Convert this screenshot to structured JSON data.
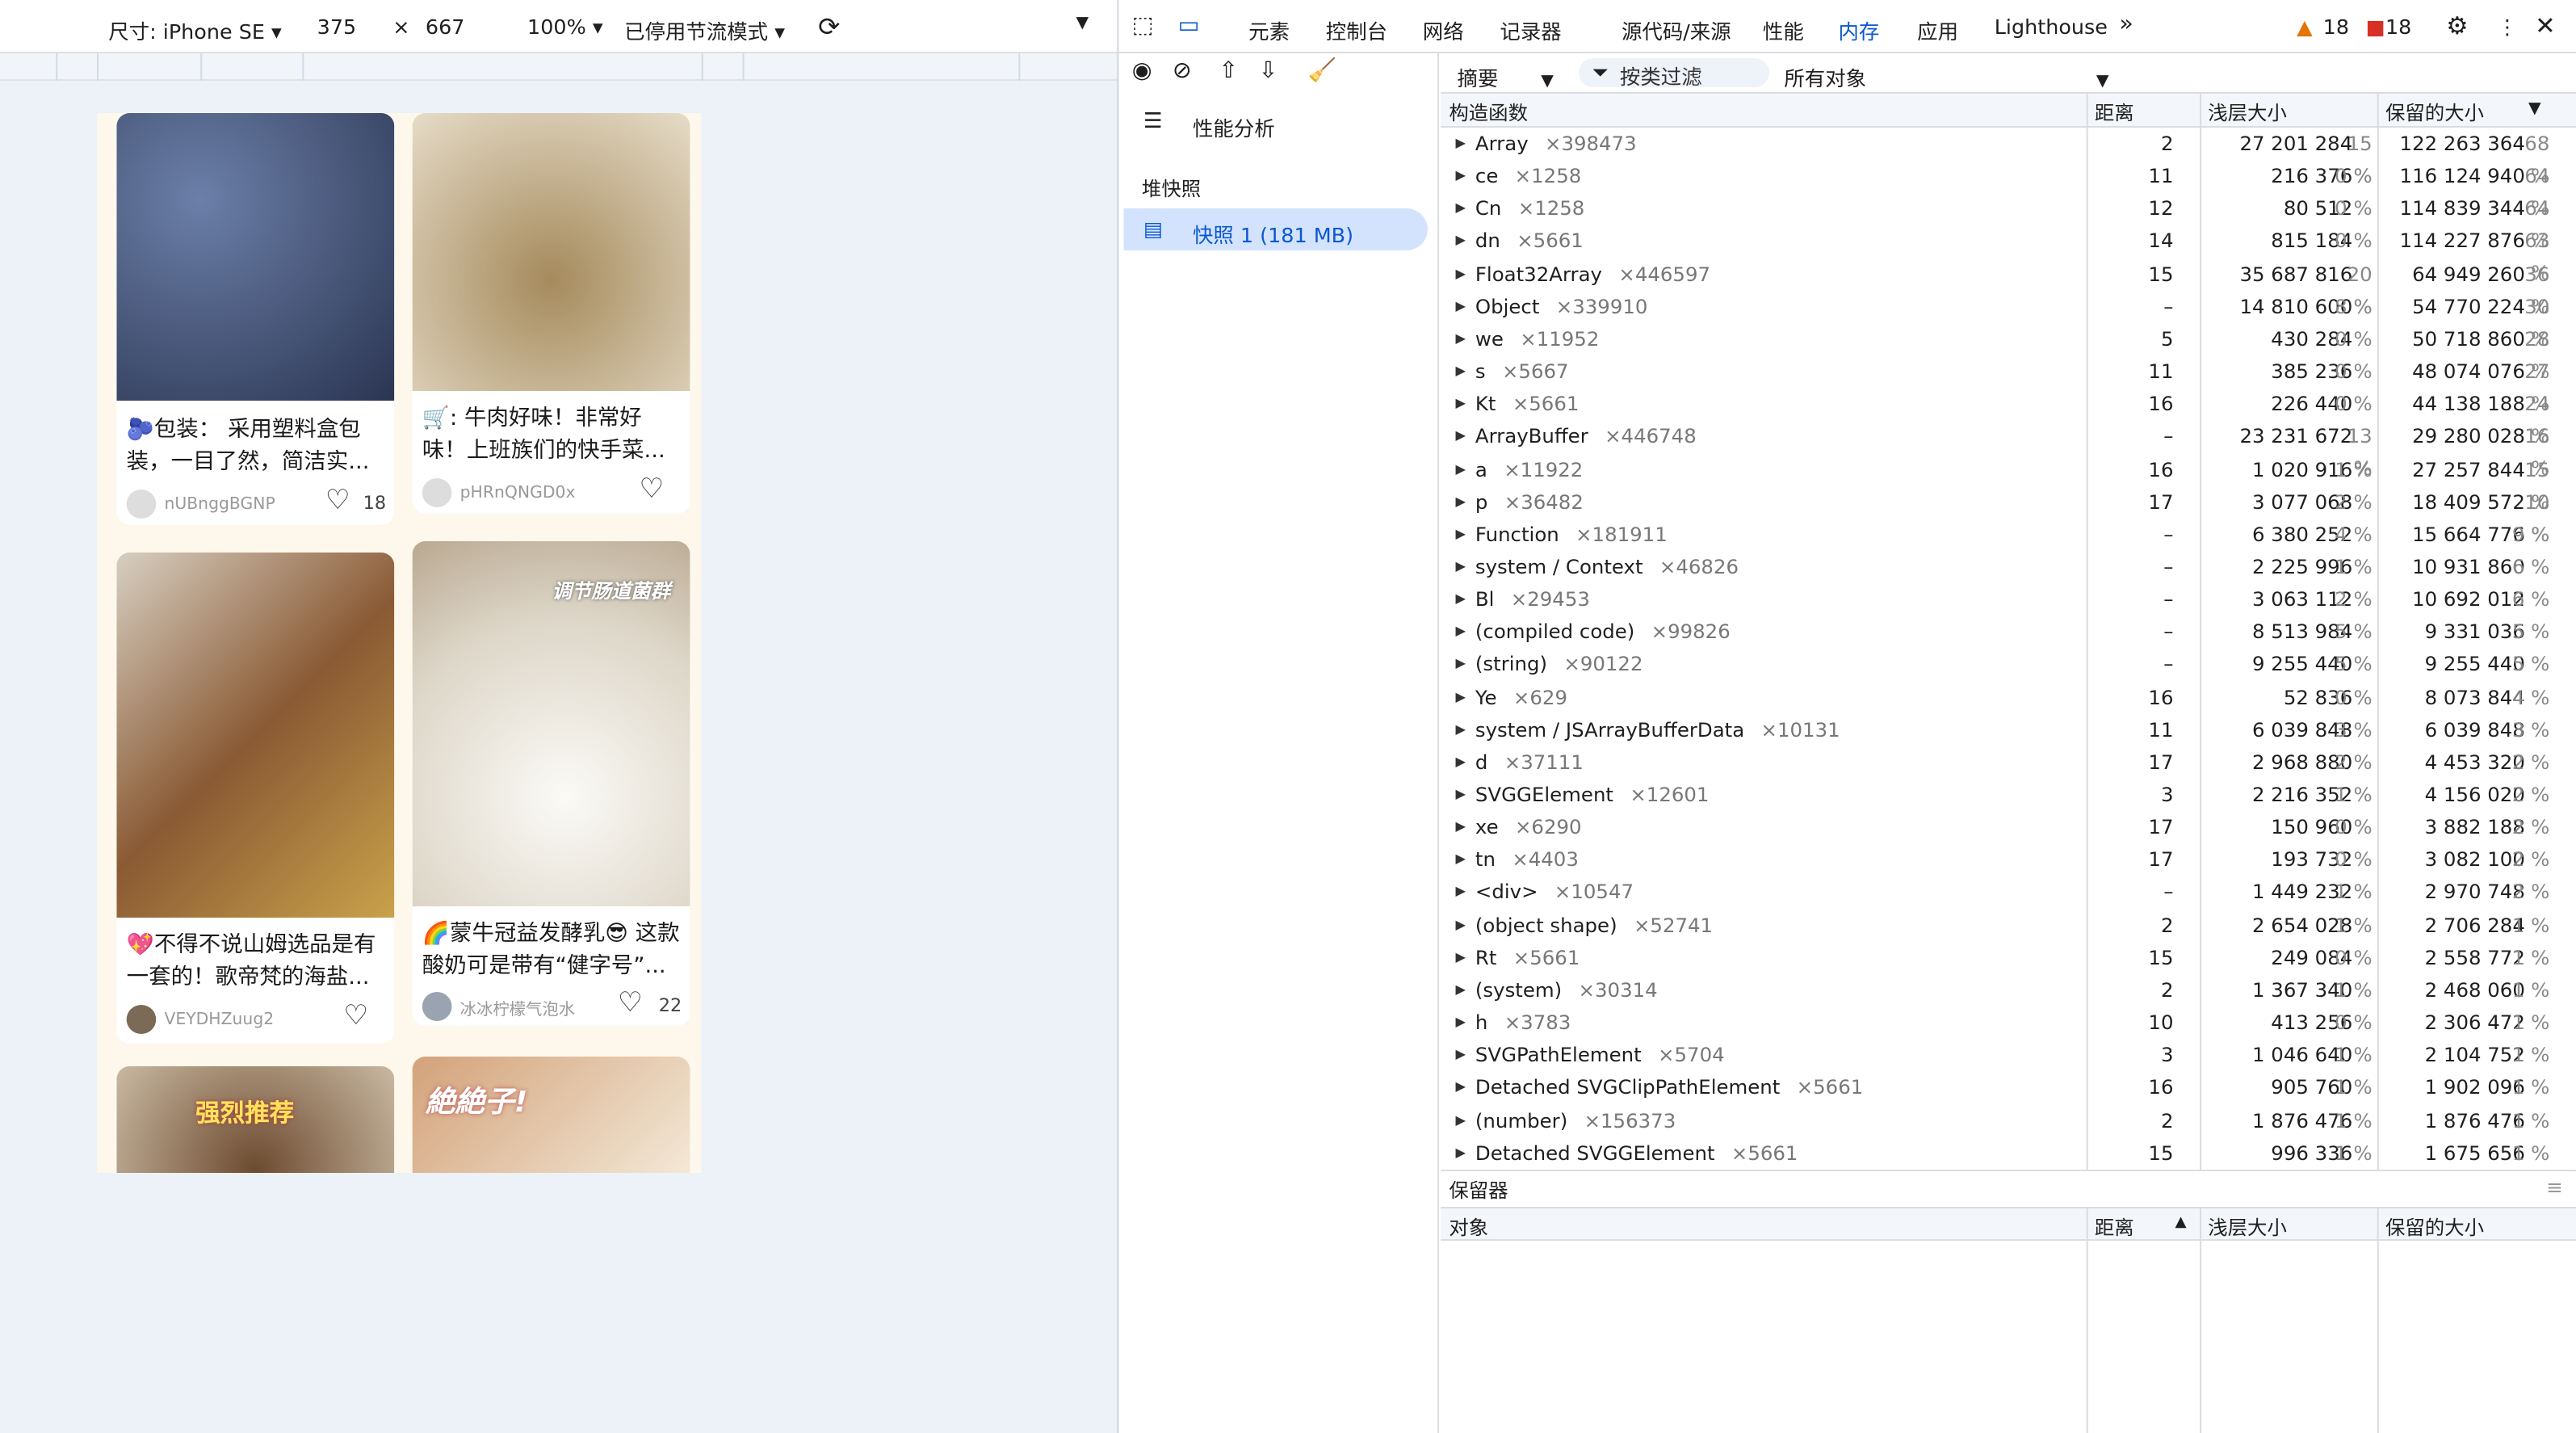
{
  "device_toolbar": {
    "size_label": "尺寸: iPhone SE",
    "width": "375",
    "times": "×",
    "height": "667",
    "zoom": "100%",
    "throttle": "已停用节流模式"
  },
  "feed": [
    {
      "title": "🫐包装： 采用塑料盒包装，一目了然，简洁实...",
      "user": "nUBnggBGNP",
      "likes": "18",
      "img_color": "#3b4a6b",
      "img_text": ""
    },
    {
      "title": "🛒: 牛肉好味！非常好味！上班族们的快手菜...",
      "user": "pHRnQNGD0x",
      "likes": "",
      "img_color": "#c9b48a",
      "img_text": ""
    },
    {
      "title": "💖不得不说山姆选品是有一套的！歌帝梵的海盐...",
      "user": "VEYDHZuug2",
      "likes": "",
      "img_color": "#b88a52",
      "img_text": ""
    },
    {
      "title": "🌈蒙牛冠益发酵乳😎 这款酸奶可是带有“健字号”...",
      "user": "冰冰柠檬气泡水",
      "likes": "22",
      "img_color": "#e8e4dc",
      "img_text": "调节肠道菌群"
    },
    {
      "title": "",
      "user": "",
      "likes": "",
      "img_color": "#8a6a48",
      "img_text": "强烈推荐"
    },
    {
      "title": "",
      "user": "",
      "likes": "",
      "img_color": "#c8a27a",
      "img_text": "絶絶子!"
    }
  ],
  "tabs": [
    "元素",
    "控制台",
    "网络",
    "记录器",
    "源代码/来源",
    "性能",
    "内存",
    "应用",
    "Lighthouse"
  ],
  "active_tab": "内存",
  "warnings": "18",
  "errors": "18",
  "sidebar": {
    "profile_label": "性能分析",
    "heap_label": "堆快照",
    "snapshot": "快照 1 (181 MB)"
  },
  "filter": {
    "view": "摘要",
    "class_filter": "按类过滤",
    "objects": "所有对象"
  },
  "columns": {
    "constructor": "构造函数",
    "distance": "距离",
    "shallow": "浅层大小",
    "retained": "保留的大小"
  },
  "rows": [
    [
      "Array",
      "×398473",
      "2",
      "27 201 284",
      "15 %",
      "122 263 364",
      "68 %"
    ],
    [
      "ce",
      "×1258",
      "11",
      "216 376",
      "0 %",
      "116 124 940",
      "64 %"
    ],
    [
      "Cn",
      "×1258",
      "12",
      "80 512",
      "0 %",
      "114 839 344",
      "64 %"
    ],
    [
      "dn",
      "×5661",
      "14",
      "815 184",
      "0 %",
      "114 227 876",
      "63 %"
    ],
    [
      "Float32Array",
      "×446597",
      "15",
      "35 687 816",
      "20 %",
      "64 949 260",
      "36 %"
    ],
    [
      "Object",
      "×339910",
      "–",
      "14 810 600",
      "8 %",
      "54 770 224",
      "30 %"
    ],
    [
      "we",
      "×11952",
      "5",
      "430 284",
      "0 %",
      "50 718 860",
      "28 %"
    ],
    [
      "s",
      "×5667",
      "11",
      "385 236",
      "0 %",
      "48 074 076",
      "27 %"
    ],
    [
      "Kt",
      "×5661",
      "16",
      "226 440",
      "0 %",
      "44 138 188",
      "24 %"
    ],
    [
      "ArrayBuffer",
      "×446748",
      "–",
      "23 231 672",
      "13 %",
      "29 280 028",
      "16 %"
    ],
    [
      "a",
      "×11922",
      "16",
      "1 020 916",
      "1 %",
      "27 257 844",
      "15 %"
    ],
    [
      "p",
      "×36482",
      "17",
      "3 077 068",
      "2 %",
      "18 409 572",
      "10 %"
    ],
    [
      "Function",
      "×181911",
      "–",
      "6 380 252",
      "4 %",
      "15 664 776",
      "9 %"
    ],
    [
      "system / Context",
      "×46826",
      "–",
      "2 225 996",
      "1 %",
      "10 931 860",
      "6 %"
    ],
    [
      "Bl",
      "×29453",
      "–",
      "3 063 112",
      "2 %",
      "10 692 012",
      "6 %"
    ],
    [
      "(compiled code)",
      "×99826",
      "–",
      "8 513 984",
      "5 %",
      "9 331 036",
      "5 %"
    ],
    [
      "(string)",
      "×90122",
      "–",
      "9 255 440",
      "5 %",
      "9 255 440",
      "5 %"
    ],
    [
      "Ye",
      "×629",
      "16",
      "52 836",
      "0 %",
      "8 073 844",
      "4 %"
    ],
    [
      "system / JSArrayBufferData",
      "×10131",
      "11",
      "6 039 848",
      "3 %",
      "6 039 848",
      "3 %"
    ],
    [
      "d",
      "×37111",
      "17",
      "2 968 880",
      "2 %",
      "4 453 320",
      "2 %"
    ],
    [
      "SVGGElement",
      "×12601",
      "3",
      "2 216 352",
      "1 %",
      "4 156 020",
      "2 %"
    ],
    [
      "xe",
      "×6290",
      "17",
      "150 960",
      "0 %",
      "3 882 188",
      "2 %"
    ],
    [
      "tn",
      "×4403",
      "17",
      "193 732",
      "0 %",
      "3 082 100",
      "2 %"
    ],
    [
      "<div>",
      "×10547",
      "–",
      "1 449 232",
      "1 %",
      "2 970 748",
      "2 %"
    ],
    [
      "(object shape)",
      "×52741",
      "2",
      "2 654 028",
      "1 %",
      "2 706 284",
      "1 %"
    ],
    [
      "Rt",
      "×5661",
      "15",
      "249 084",
      "0 %",
      "2 558 772",
      "1 %"
    ],
    [
      "(system)",
      "×30314",
      "2",
      "1 367 340",
      "1 %",
      "2 468 060",
      "1 %"
    ],
    [
      "h",
      "×3783",
      "10",
      "413 256",
      "0 %",
      "2 306 472",
      "1 %"
    ],
    [
      "SVGPathElement",
      "×5704",
      "3",
      "1 046 640",
      "1 %",
      "2 104 752",
      "1 %"
    ],
    [
      "Detached SVGClipPathElement",
      "×5661",
      "16",
      "905 760",
      "1 %",
      "1 902 096",
      "1 %"
    ],
    [
      "(number)",
      "×156373",
      "2",
      "1 876 476",
      "1 %",
      "1 876 476",
      "1 %"
    ],
    [
      "Detached SVGGElement",
      "×5661",
      "15",
      "996 336",
      "1 %",
      "1 675 656",
      "1 %"
    ]
  ],
  "retainers": {
    "title": "保留器",
    "object": "对象",
    "distance": "距离",
    "shallow": "浅层大小",
    "retained": "保留的大小"
  }
}
